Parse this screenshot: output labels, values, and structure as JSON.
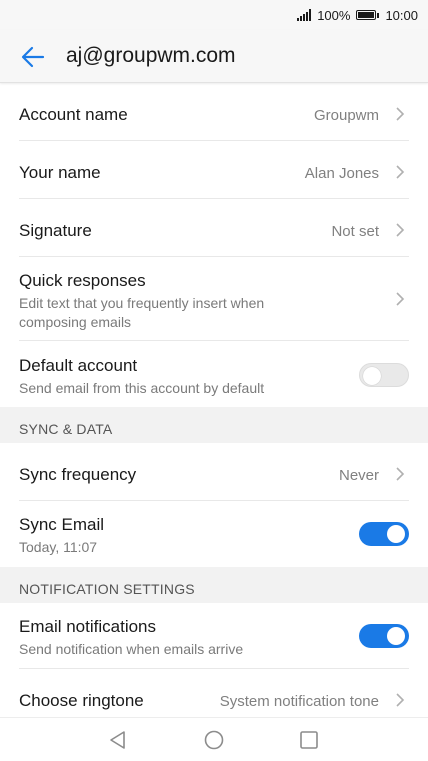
{
  "status_bar": {
    "battery_percent": "100%",
    "time": "10:00"
  },
  "app_bar": {
    "title": "aj@groupwm.com"
  },
  "account": {
    "account_name": {
      "label": "Account name",
      "value": "Groupwm"
    },
    "your_name": {
      "label": "Your name",
      "value": "Alan Jones"
    },
    "signature": {
      "label": "Signature",
      "value": "Not set"
    },
    "quick_responses": {
      "label": "Quick responses",
      "description": "Edit text that you frequently insert when composing emails"
    },
    "default_account": {
      "label": "Default account",
      "description": "Send email from this account by default",
      "enabled": false
    }
  },
  "sync": {
    "header": "SYNC & DATA",
    "frequency": {
      "label": "Sync frequency",
      "value": "Never"
    },
    "sync_email": {
      "label": "Sync Email",
      "description": "Today, 11:07",
      "enabled": true
    }
  },
  "notifications": {
    "header": "NOTIFICATION SETTINGS",
    "email_notifications": {
      "label": "Email notifications",
      "description": "Send notification when emails arrive",
      "enabled": true
    },
    "ringtone": {
      "label": "Choose ringtone",
      "value": "System notification tone"
    }
  },
  "colors": {
    "accent": "#1a7ae6",
    "toggle_off": "#e9e9e9",
    "section_bg": "#f2f2f2"
  }
}
